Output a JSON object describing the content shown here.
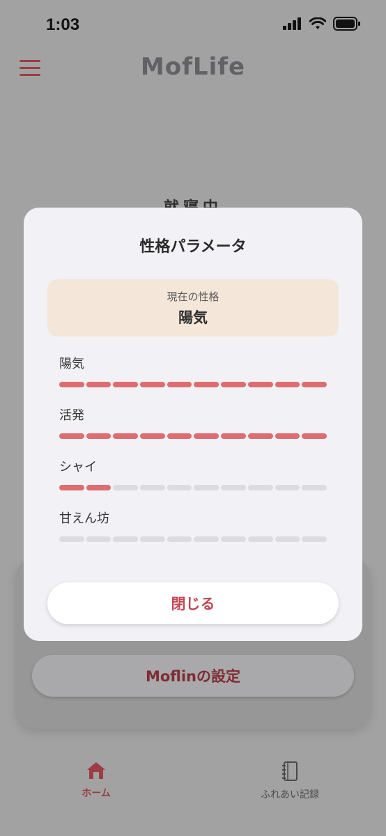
{
  "status_bar": {
    "time": "1:03"
  },
  "header": {
    "title": "MofLife",
    "sleep_status": "就寝中"
  },
  "modal": {
    "title": "性格パラメータ",
    "current_label": "現在の性格",
    "current_value": "陽気",
    "parameters": [
      {
        "label": "陽気",
        "level": 10,
        "max": 10
      },
      {
        "label": "活発",
        "level": 10,
        "max": 10
      },
      {
        "label": "シャイ",
        "level": 2,
        "max": 10
      },
      {
        "label": "甘えん坊",
        "level": 0,
        "max": 10
      }
    ],
    "close_label": "閉じる"
  },
  "background_card": {
    "settings_button": "Moflinの設定"
  },
  "tab_bar": {
    "tabs": [
      {
        "label": "ホーム",
        "icon": "home-icon",
        "active": true
      },
      {
        "label": "ふれあい記録",
        "icon": "notebook-icon",
        "active": false
      }
    ]
  },
  "colors": {
    "accent": "#9c3c44",
    "bar_on": "#dd6d70",
    "bar_off": "#dcdbe0",
    "current_bg": "#f4e6d9",
    "close_text": "#c24854"
  }
}
